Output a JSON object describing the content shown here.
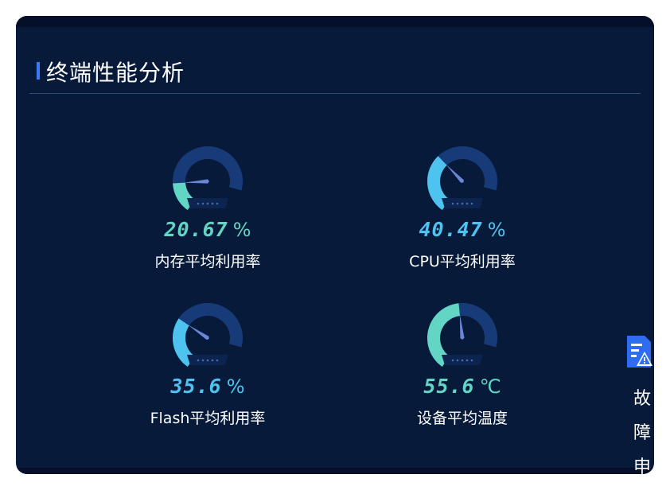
{
  "panel": {
    "title": "终端性能分析"
  },
  "gauges": [
    {
      "value": "20.67",
      "unit": "%",
      "label": "内存平均利用率",
      "fraction": 0.2067,
      "color": "#62d5c4"
    },
    {
      "value": "40.47",
      "unit": "%",
      "label": "CPU平均利用率",
      "fraction": 0.4047,
      "color": "#4ec3f0"
    },
    {
      "value": "35.6",
      "unit": "%",
      "label": "Flash平均利用率",
      "fraction": 0.356,
      "color": "#4ec3f0"
    },
    {
      "value": "55.6",
      "unit": "℃",
      "label": "设备平均温度",
      "fraction": 0.556,
      "color": "#62d5c4"
    }
  ],
  "fault_widget": {
    "icon": "fault-report-icon",
    "text": "故障申"
  },
  "colors": {
    "panel_bg": "#071a3a",
    "gauge_track": "#173a78",
    "title_accent": "#3a7bf4"
  }
}
